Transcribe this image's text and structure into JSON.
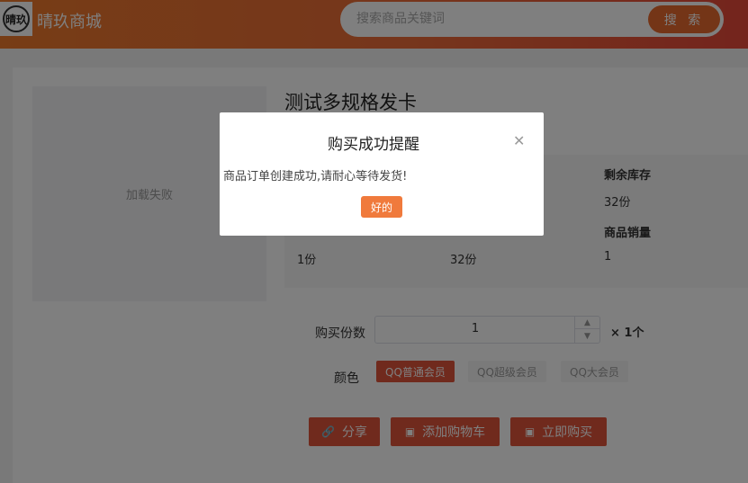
{
  "header": {
    "logo_text": "晴玖",
    "brand": "晴玖商城",
    "search_placeholder": "搜索商品关键词",
    "search_button": "搜 索"
  },
  "product": {
    "image_failed_text": "加载失败",
    "title": "测试多规格发卡",
    "info": [
      {
        "head": "剩余库存",
        "value": "32份"
      },
      {
        "head": "",
        "value": "1份"
      },
      {
        "head": "",
        "value": "32份"
      },
      {
        "head": "商品销量",
        "value": "1"
      }
    ],
    "qty_label": "购买份数",
    "qty_value": "1",
    "multiplier": "× 1个",
    "color_label": "颜色",
    "color_options": [
      "QQ普通会员",
      "QQ超级会员",
      "QQ大会员"
    ],
    "actions": {
      "share": "分享",
      "add_cart": "添加购物车",
      "buy_now": "立即购买"
    }
  },
  "modal": {
    "title": "购买成功提醒",
    "message": "商品订单创建成功,请耐心等待发货!",
    "ok": "好的"
  },
  "colors": {
    "accent": "#e0553a",
    "header_start": "#ee7a2c",
    "header_end": "#e8493a"
  }
}
